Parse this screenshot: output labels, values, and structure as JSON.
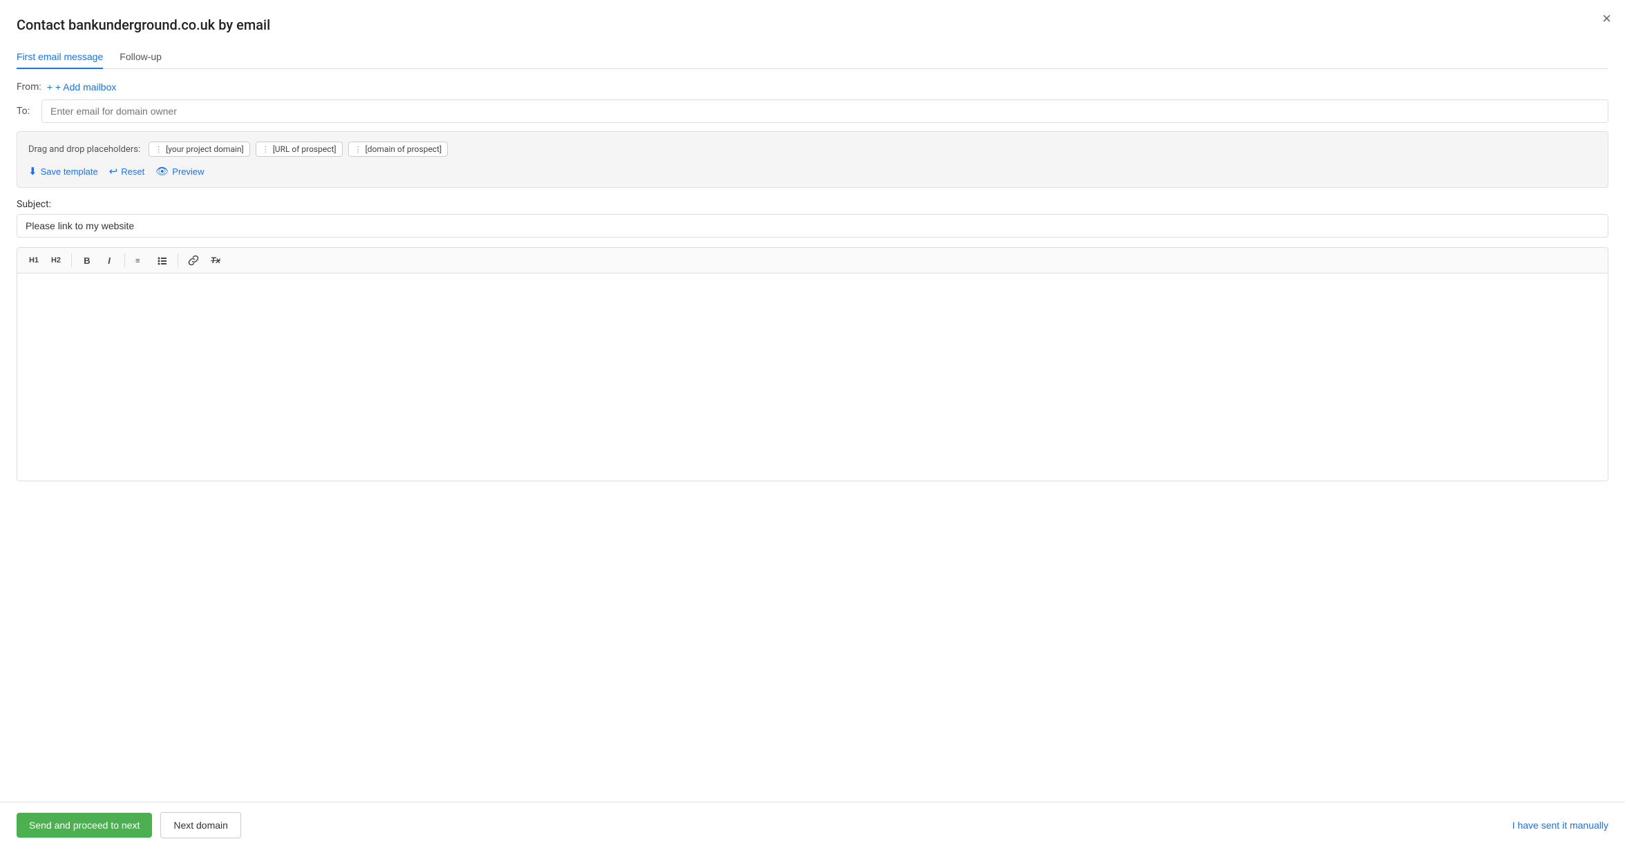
{
  "modal": {
    "title": "Contact bankunderground.co.uk by email",
    "close_label": "×"
  },
  "tabs": [
    {
      "id": "first",
      "label": "First email message",
      "active": true
    },
    {
      "id": "followup",
      "label": "Follow-up",
      "active": false
    }
  ],
  "from_section": {
    "label": "From:",
    "add_mailbox_label": "+ Add mailbox"
  },
  "to_section": {
    "label": "To:",
    "placeholder": "Enter email for domain owner"
  },
  "placeholders": {
    "label": "Drag and drop placeholders:",
    "chips": [
      {
        "text": "[your project domain]"
      },
      {
        "text": "[URL of prospect]"
      },
      {
        "text": "[domain of prospect]"
      }
    ]
  },
  "toolbar": {
    "save_template_label": "Save template",
    "reset_label": "Reset",
    "preview_label": "Preview"
  },
  "subject": {
    "label": "Subject:",
    "value": "Please link to my website"
  },
  "editor": {
    "tools": [
      {
        "id": "h1",
        "label": "H1"
      },
      {
        "id": "h2",
        "label": "H2"
      },
      {
        "id": "bold",
        "label": "B"
      },
      {
        "id": "italic",
        "label": "I"
      },
      {
        "id": "ordered-list",
        "label": "≡"
      },
      {
        "id": "unordered-list",
        "label": "☰"
      },
      {
        "id": "link",
        "label": "🔗"
      },
      {
        "id": "clear-format",
        "label": "Tx"
      }
    ],
    "content": ""
  },
  "footer": {
    "send_label": "Send and proceed to next",
    "next_domain_label": "Next domain",
    "sent_manually_label": "I have sent it manually"
  }
}
